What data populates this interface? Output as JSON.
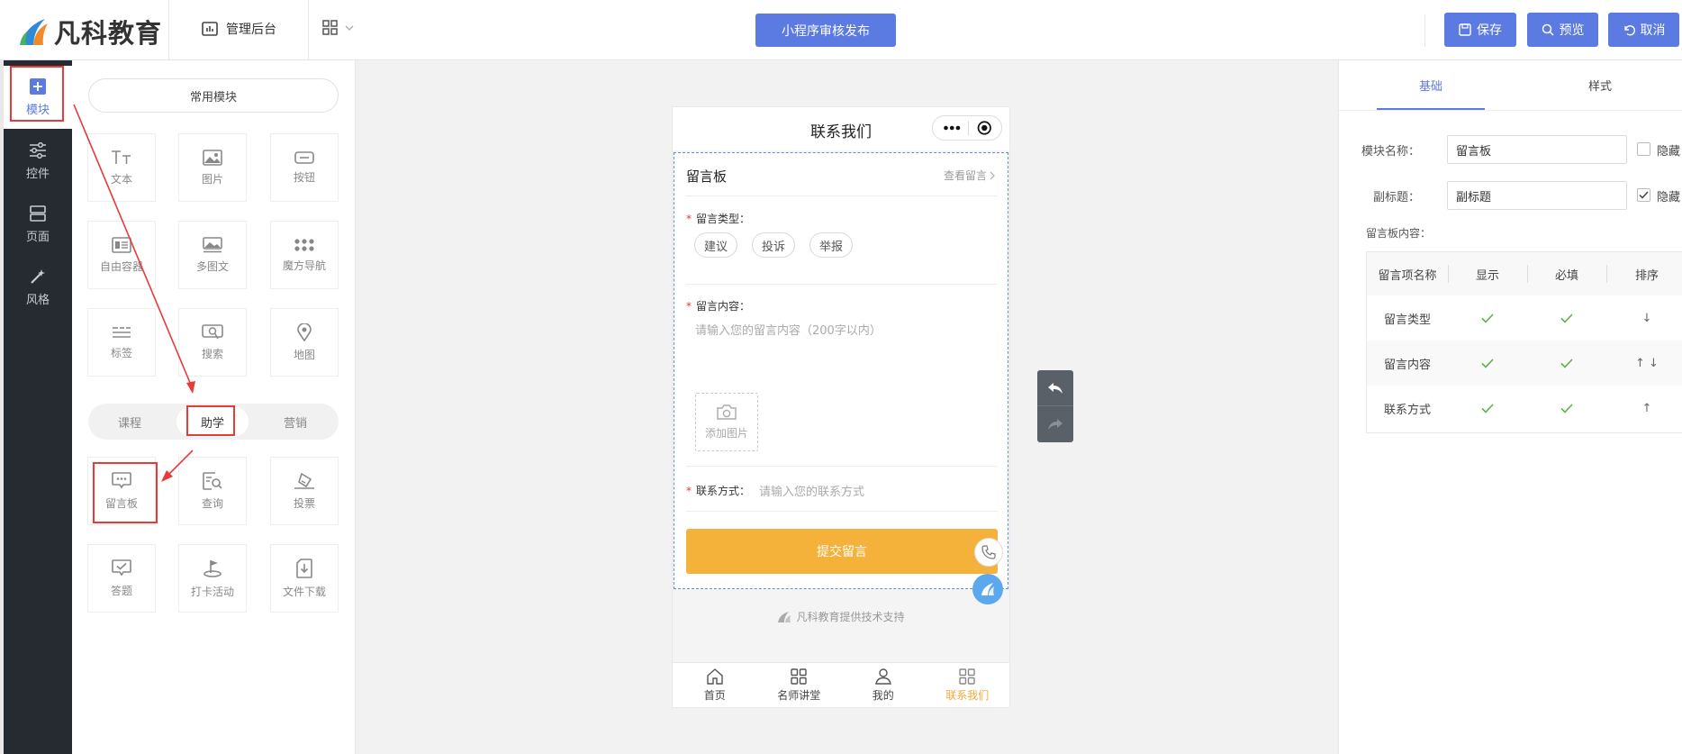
{
  "header": {
    "brand": "凡科教育",
    "admin_link": "管理后台",
    "publish_button": "小程序审核发布",
    "save_button": "保存",
    "preview_button": "预览",
    "cancel_button": "取消"
  },
  "rail": {
    "items": [
      {
        "label": "模块",
        "icon": "plus-square-icon",
        "active": true
      },
      {
        "label": "控件",
        "icon": "sliders-icon"
      },
      {
        "label": "页面",
        "icon": "page-layout-icon"
      },
      {
        "label": "风格",
        "icon": "magic-wand-icon"
      }
    ]
  },
  "modules": {
    "common_title": "常用模块",
    "common": [
      {
        "label": "文本",
        "icon": "text-icon"
      },
      {
        "label": "图片",
        "icon": "image-icon"
      },
      {
        "label": "按钮",
        "icon": "button-icon"
      },
      {
        "label": "自由容器",
        "icon": "container-icon"
      },
      {
        "label": "多图文",
        "icon": "multi-image-icon"
      },
      {
        "label": "魔方导航",
        "icon": "dots-grid-icon"
      },
      {
        "label": "标签",
        "icon": "tag-lines-icon"
      },
      {
        "label": "搜索",
        "icon": "search-icon"
      },
      {
        "label": "地图",
        "icon": "map-pin-icon"
      }
    ],
    "categories": [
      "课程",
      "助学",
      "营销"
    ],
    "active_category": "助学",
    "study": [
      {
        "label": "留言板",
        "icon": "message-board-icon"
      },
      {
        "label": "查询",
        "icon": "query-icon"
      },
      {
        "label": "投票",
        "icon": "vote-icon"
      },
      {
        "label": "答题",
        "icon": "quiz-icon"
      },
      {
        "label": "打卡活动",
        "icon": "flag-icon"
      },
      {
        "label": "文件下载",
        "icon": "file-download-icon"
      }
    ]
  },
  "phone": {
    "title": "联系我们",
    "board": {
      "title": "留言板",
      "view_link": "查看留言",
      "type_label": "留言类型：",
      "types": [
        "建议",
        "投诉",
        "举报"
      ],
      "content_label": "留言内容：",
      "content_placeholder": "请输入您的留言内容（200字以内）",
      "add_image": "添加图片",
      "contact_label": "联系方式：",
      "contact_placeholder": "请输入您的联系方式",
      "submit": "提交留言"
    },
    "support_text": "凡科教育提供技术支持",
    "tabs": [
      {
        "label": "首页",
        "icon": "home-icon"
      },
      {
        "label": "名师讲堂",
        "icon": "grid-icon"
      },
      {
        "label": "我的",
        "icon": "user-icon"
      },
      {
        "label": "联系我们",
        "icon": "grid-icon",
        "active": true
      }
    ]
  },
  "settings": {
    "tabs": [
      "基础",
      "样式"
    ],
    "active_tab": "基础",
    "module_name_label": "模块名称：",
    "module_name_value": "留言板",
    "subtitle_label": "副标题：",
    "subtitle_value": "副标题",
    "hide_label": "隐藏",
    "hide_module_name": false,
    "hide_subtitle": true,
    "content_label": "留言板内容：",
    "table": {
      "headers": [
        "留言项名称",
        "显示",
        "必填",
        "排序"
      ],
      "rows": [
        {
          "name": "留言类型",
          "show": true,
          "required": true,
          "sort": "↓"
        },
        {
          "name": "留言内容",
          "show": true,
          "required": true,
          "sort": "↑ ↓"
        },
        {
          "name": "联系方式",
          "show": true,
          "required": true,
          "sort": "↑"
        }
      ]
    }
  },
  "colors": {
    "primary": "#5b7be2",
    "rail_bg": "#262a31",
    "submit": "#f4b23b",
    "annotation": "#e53b3b",
    "check": "#5fb04a"
  }
}
